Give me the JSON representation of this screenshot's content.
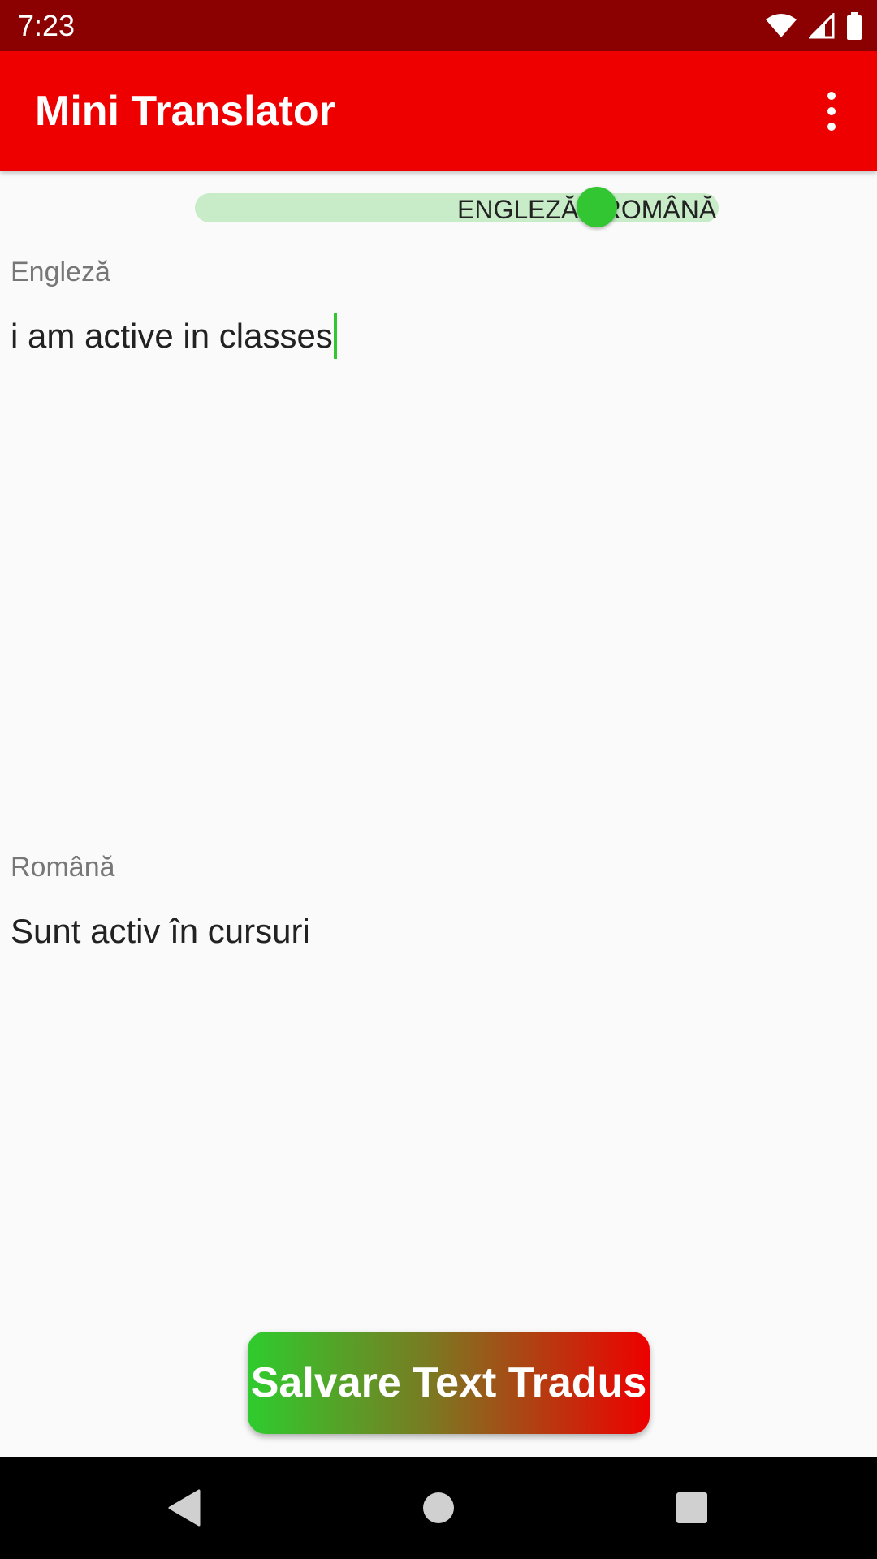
{
  "status_bar": {
    "time": "7:23",
    "icons": [
      "wifi-icon",
      "signal-icon",
      "battery-icon"
    ]
  },
  "app_bar": {
    "title": "Mini Translator",
    "overflow_icon": "more-vert-icon"
  },
  "language_switch": {
    "label": "ENGLEZĂ->ROMÂNĂ",
    "checked": true,
    "track_color": "#c8ecc8",
    "thumb_color": "#33c633"
  },
  "source": {
    "label": "Engleză",
    "value": "i am active in classes"
  },
  "target": {
    "label": "Română",
    "value": "Sunt activ în cursuri"
  },
  "save_button": {
    "label": "Salvare Text Tradus",
    "gradient": [
      "#2ecc2e",
      "#ee0000"
    ]
  },
  "nav_bar": {
    "items": [
      "back-icon",
      "home-icon",
      "recents-icon"
    ]
  },
  "colors": {
    "status_bar": "#8b0000",
    "app_bar": "#ee0000",
    "accent": "#33c633",
    "background": "#fafafa"
  }
}
